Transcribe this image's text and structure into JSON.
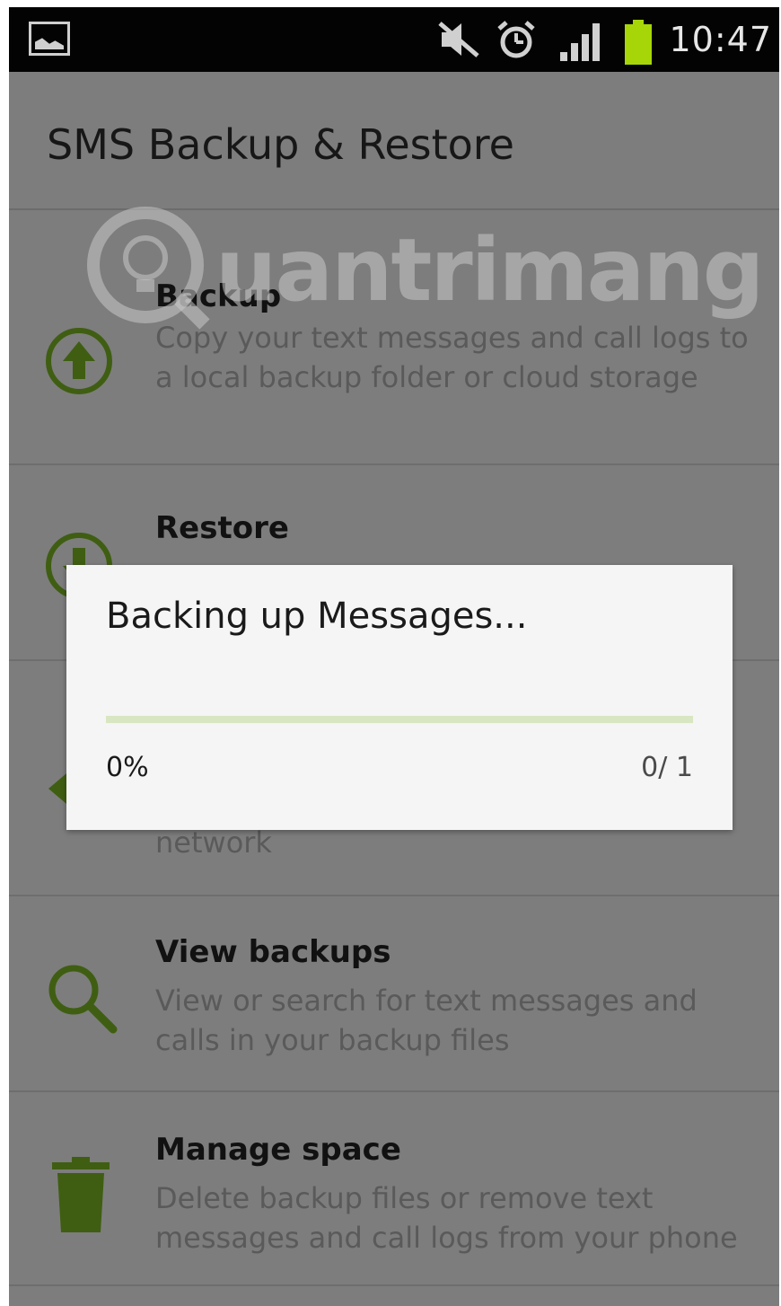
{
  "status_bar": {
    "time": "10:47",
    "icons": [
      "gallery-icon",
      "muted-icon",
      "alarm-icon",
      "signal-icon",
      "battery-icon"
    ],
    "battery_color": "#a6d608"
  },
  "app": {
    "title": "SMS Backup & Restore",
    "accent_color": "#3f5e12"
  },
  "watermark": {
    "text": "uantrimang"
  },
  "menu": [
    {
      "title": "Backup",
      "icon": "upload-icon",
      "description": "Copy your text messages and call logs to a local backup folder or cloud storage"
    },
    {
      "title": "Restore",
      "icon": "download-icon",
      "description": ""
    },
    {
      "title": "",
      "icon": "transfer-icon",
      "description": "network"
    },
    {
      "title": "View backups",
      "icon": "search-icon",
      "description": "View or search for text messages and calls in your backup files"
    },
    {
      "title": "Manage space",
      "icon": "trash-icon",
      "description": "Delete backup files or remove text messages and call logs from your phone"
    }
  ],
  "dialog": {
    "title": "Backing up Messages...",
    "percent": "0%",
    "count": "0/ 1",
    "progress_fraction": 0
  }
}
